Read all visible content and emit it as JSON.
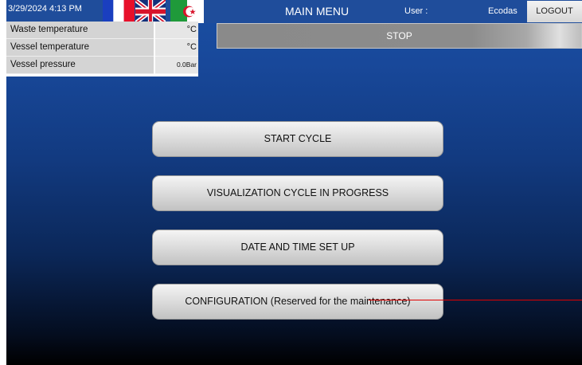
{
  "header": {
    "datetime": "3/29/2024 4:13 PM",
    "title": "MAIN MENU",
    "user_label": "User :",
    "user_name": "Ecodas",
    "logout_label": "LOGOUT"
  },
  "flags": [
    {
      "name": "french-flag",
      "colors": [
        "#1a3fbf",
        "#ffffff",
        "#e8102a"
      ]
    },
    {
      "name": "uk-flag",
      "colors": [
        "#12307a",
        "#ffffff",
        "#d8142b"
      ]
    },
    {
      "name": "algerian-flag",
      "colors": [
        "#1f9a3a",
        "#ffffff",
        "#d8142b"
      ]
    }
  ],
  "sensors": [
    {
      "label": "Waste temperature",
      "value": "°C"
    },
    {
      "label": "Vessel temperature",
      "value": "°C"
    },
    {
      "label": "Vessel pressure",
      "value": "0.0Bar"
    }
  ],
  "status": {
    "text": "STOP"
  },
  "menu": {
    "start_cycle": "START CYCLE",
    "visualization": "VISUALIZATION CYCLE IN PROGRESS",
    "date_time": "DATE AND TIME SET UP",
    "configuration": "CONFIGURATION (Reserved for the maintenance)"
  },
  "colors": {
    "background_top": "#1a4fa3",
    "background_bottom": "#000000",
    "annotation_line": "#e00000"
  }
}
